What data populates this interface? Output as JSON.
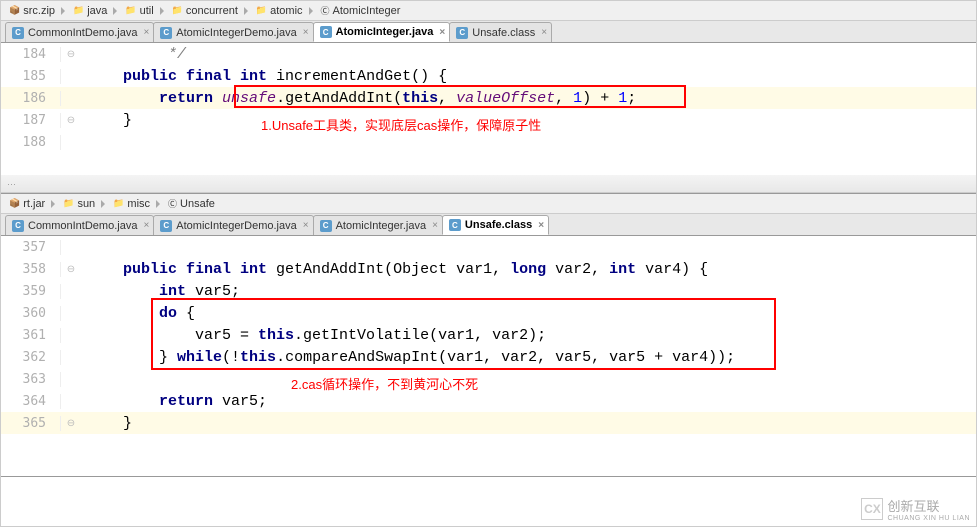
{
  "top": {
    "breadcrumb": [
      "src.zip",
      "java",
      "util",
      "concurrent",
      "atomic",
      "AtomicInteger"
    ],
    "tabs": [
      {
        "label": "CommonIntDemo.java",
        "active": false
      },
      {
        "label": "AtomicIntegerDemo.java",
        "active": false
      },
      {
        "label": "AtomicInteger.java",
        "active": true
      },
      {
        "label": "Unsafe.class",
        "active": false
      }
    ],
    "lines": {
      "184": {
        "code": "*/",
        "type": "cmt"
      },
      "185": {
        "code": "public final int incrementAndGet() {"
      },
      "186": {
        "code": "return unsafe.getAndAddInt(this, valueOffset, 1) + 1;",
        "hl": true
      },
      "187": {
        "code": "}"
      },
      "188": {
        "code": ""
      }
    },
    "annotation": "1.Unsafe工具类，实现底层cas操作，保障原子性"
  },
  "bottom": {
    "breadcrumb": [
      "rt.jar",
      "sun",
      "misc",
      "Unsafe"
    ],
    "tabs": [
      {
        "label": "CommonIntDemo.java",
        "active": false
      },
      {
        "label": "AtomicIntegerDemo.java",
        "active": false
      },
      {
        "label": "AtomicInteger.java",
        "active": false
      },
      {
        "label": "Unsafe.class",
        "active": true
      }
    ],
    "lines": {
      "357": {
        "code": ""
      },
      "358": {
        "code": "public final int getAndAddInt(Object var1, long var2, int var4) {"
      },
      "359": {
        "code": "int var5;"
      },
      "360": {
        "code": "do {"
      },
      "361": {
        "code": "var5 = this.getIntVolatile(var1, var2);"
      },
      "362": {
        "code": "} while(!this.compareAndSwapInt(var1, var2, var5, var5 + var4));"
      },
      "363": {
        "code": ""
      },
      "364": {
        "code": "return var5;"
      },
      "365": {
        "code": "}",
        "hl": true
      }
    },
    "annotation": "2.cas循环操作，不到黄河心不死"
  },
  "watermark": {
    "logo": "CX",
    "line1": "创新互联",
    "line2": "CHUANG XIN HU LIAN"
  }
}
